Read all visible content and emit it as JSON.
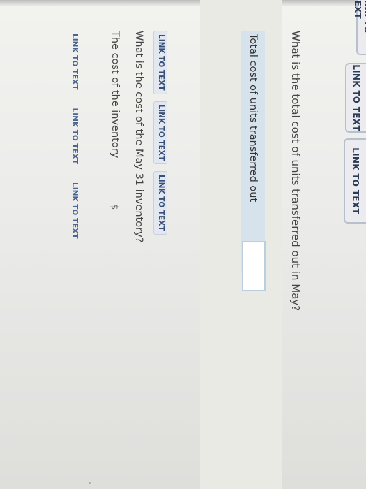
{
  "tabs": [
    "LINK TO TEXT",
    "LINK TO TEXT",
    "LINK TO TEXT"
  ],
  "question1": {
    "text": "What is the total cost of units transferred out in May?",
    "row_label": "Total cost of units transferred out",
    "currency": "$",
    "value": ""
  },
  "links1": [
    "LINK TO TEXT",
    "LINK TO TEXT",
    "LINK TO TEXT"
  ],
  "question2": {
    "text": "What is the cost of the May 31 inventory?",
    "row_label": "The cost of the inventory",
    "currency": "$"
  },
  "links2": [
    "LINK TO TEXT",
    "LINK TO TEXT",
    "LINK TO TEXT"
  ],
  "colors": {
    "row_highlight": "#d7e3ec",
    "link": "#3a4f78",
    "input_border": "#b9cfe0"
  }
}
